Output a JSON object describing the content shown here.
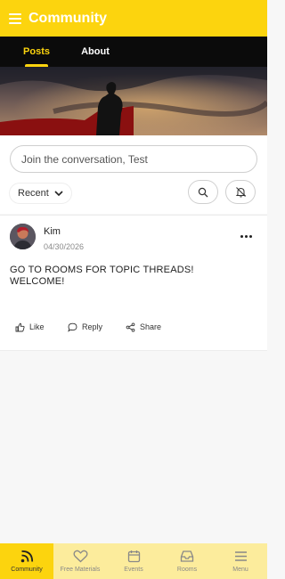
{
  "header": {
    "title": "Community"
  },
  "tabs": [
    {
      "label": "Posts",
      "active": true
    },
    {
      "label": "About",
      "active": false
    }
  ],
  "composer": {
    "placeholder": "Join the conversation, Test"
  },
  "filter": {
    "sort_label": "Recent"
  },
  "post": {
    "author": "Kim",
    "date": "04/30/2026",
    "body_line1": "GO TO ROOMS FOR TOPIC THREADS!",
    "body_line2": "WELCOME!",
    "actions": {
      "like": "Like",
      "reply": "Reply",
      "share": "Share"
    }
  },
  "bottom_nav": [
    {
      "label": "Community",
      "icon": "rss-icon",
      "active": true
    },
    {
      "label": "Free Materials",
      "icon": "heart-icon",
      "active": false
    },
    {
      "label": "Events",
      "icon": "calendar-icon",
      "active": false
    },
    {
      "label": "Rooms",
      "icon": "inbox-icon",
      "active": false
    },
    {
      "label": "Menu",
      "icon": "menu-icon",
      "active": false
    }
  ],
  "colors": {
    "brand": "#fcd40e",
    "nav_bg": "#fcec9c",
    "tab_bar": "#0b0b0b"
  }
}
